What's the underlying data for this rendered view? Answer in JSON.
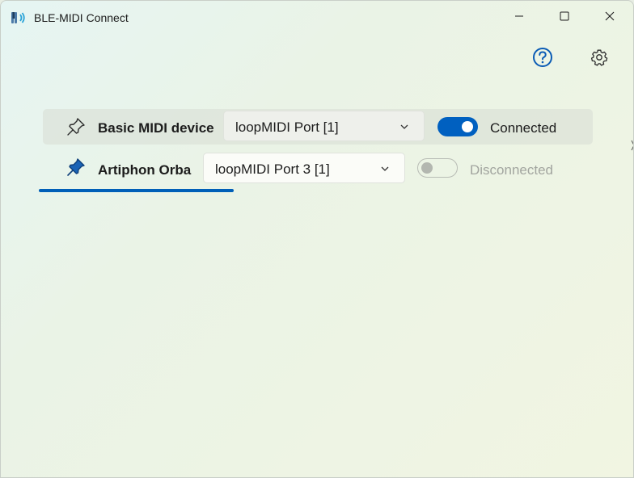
{
  "window": {
    "title": "BLE-MIDI Connect",
    "icon": "ble-midi-app-icon",
    "controls": [
      "minimize-icon",
      "maximize-icon",
      "close-icon"
    ]
  },
  "header": {
    "help_icon": "question-circle-icon",
    "settings_icon": "gear-icon"
  },
  "devices": [
    {
      "name": "Basic MIDI device",
      "pin_icon": "pin-outline-icon",
      "port": "loopMIDI Port [1]",
      "connected": true,
      "status": "Connected"
    },
    {
      "name": "Artiphon Orba",
      "pin_icon": "pin-filled-icon",
      "port": "loopMIDI Port 3 [1]",
      "connected": false,
      "status": "Disconnected"
    }
  ],
  "colors": {
    "accent": "#005fb8",
    "toggle_on": "#0060c0",
    "pin_filled": "#1a63b5",
    "disabled_text": "#a2a59f"
  }
}
